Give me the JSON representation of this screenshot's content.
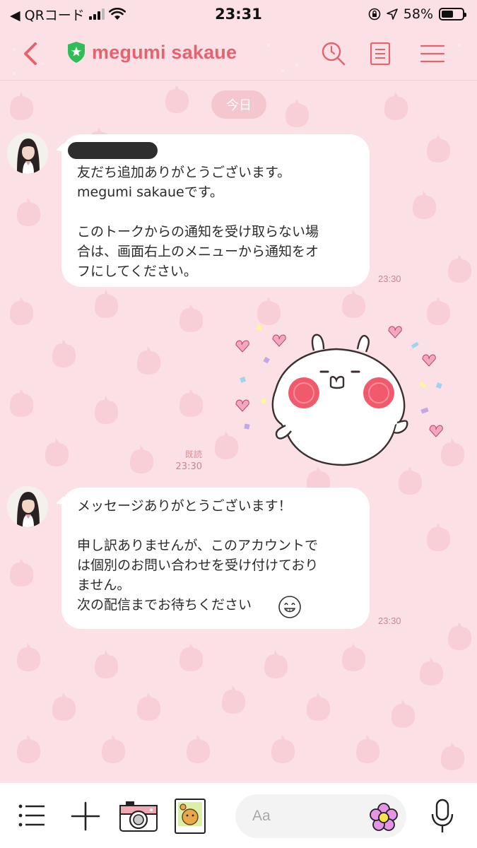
{
  "status_bar": {
    "back_app": "◀ QRコード",
    "time": "23:31",
    "battery": "58%",
    "battery_level": 0.58
  },
  "header": {
    "title": "megumi sakaue"
  },
  "chat": {
    "date_label": "今日",
    "messages": [
      {
        "text": "友だち追加ありがとうございます。\nmegumi sakaueです。\n\nこのトークからの通知を受け取らない場\n合は、画面右上のメニューから通知をオ\nフにしてください。",
        "time": "23:30"
      },
      {
        "read_label": "既読",
        "time": "23:30"
      },
      {
        "text": "メッセージありがとうございます！\n\n申し訳ありませんが、このアカウントで\nは個別のお問い合わせを受け付けており\nません。\n次の配信までお待ちください",
        "time": "23:30"
      }
    ]
  },
  "input": {
    "placeholder": "Aa"
  },
  "icons": {
    "back": "chevron-left-icon",
    "verified": "shield-star-icon",
    "search": "search-icon",
    "notes": "note-icon",
    "menu": "menu-icon",
    "list": "list-icon",
    "plus": "plus-icon",
    "camera": "camera-icon",
    "photo": "photo-icon",
    "emoji": "flower-emoji-icon",
    "mic": "microphone-icon",
    "smile": "smile-emoji-icon"
  },
  "colors": {
    "accent": "#e5626f",
    "background": "#fbe0e5",
    "verified": "#2ebd59"
  }
}
